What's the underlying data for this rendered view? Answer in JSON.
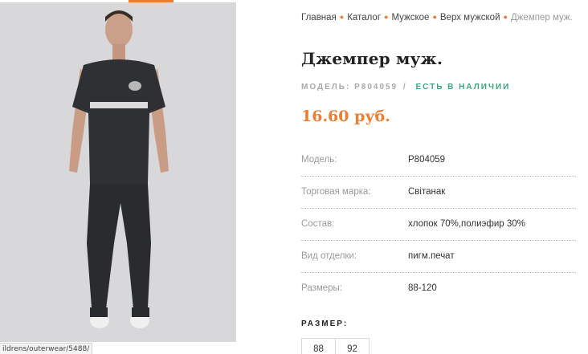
{
  "breadcrumb": {
    "items": [
      "Главная",
      "Каталог",
      "Мужское",
      "Верх мужской"
    ],
    "current": "Джемпер муж."
  },
  "product": {
    "title": "Джемпер муж.",
    "model_label": "МОДЕЛЬ: Р804059",
    "separator": "/",
    "stock": "ЕСТЬ В НАЛИЧИИ",
    "price": "16.60 руб."
  },
  "specs": [
    {
      "key": "Модель:",
      "value": "Р804059"
    },
    {
      "key": "Торговая марка:",
      "value": "Світанак"
    },
    {
      "key": "Состав:",
      "value": "хлопок 70%,полиэфир 30%"
    },
    {
      "key": "Вид отделки:",
      "value": "пигм.печат"
    },
    {
      "key": "Размеры:",
      "value": "88-120"
    }
  ],
  "size_selector": {
    "label": "РАЗМЕР:",
    "options": [
      "88",
      "92"
    ]
  },
  "status_bar": {
    "url": "ildrens/outerwear/5488/"
  },
  "colors": {
    "accent": "#ef7d2d",
    "in_stock": "#3aa57a"
  }
}
